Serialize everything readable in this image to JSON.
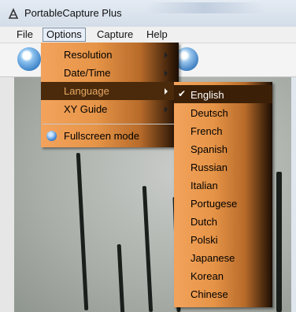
{
  "window": {
    "title": "PortableCapture Plus"
  },
  "menubar": {
    "items": [
      {
        "label": "File"
      },
      {
        "label": "Options"
      },
      {
        "label": "Capture"
      },
      {
        "label": "Help"
      }
    ]
  },
  "options_menu": {
    "items": [
      {
        "label": "Resolution",
        "submenu": true
      },
      {
        "label": "Date/Time",
        "submenu": true
      },
      {
        "label": "Language",
        "submenu": true,
        "highlighted": true
      },
      {
        "label": "XY Guide",
        "submenu": true
      }
    ],
    "fullscreen": {
      "label": "Fullscreen mode",
      "icon": "fullscreen-icon"
    }
  },
  "language_menu": {
    "selected": "English",
    "items": [
      {
        "label": "English"
      },
      {
        "label": "Deutsch"
      },
      {
        "label": "French"
      },
      {
        "label": "Spanish"
      },
      {
        "label": "Russian"
      },
      {
        "label": "Italian"
      },
      {
        "label": "Portugese"
      },
      {
        "label": "Dutch"
      },
      {
        "label": "Polski"
      },
      {
        "label": "Japanese"
      },
      {
        "label": "Korean"
      },
      {
        "label": "Chinese"
      }
    ]
  },
  "colors": {
    "menu_gradient_start": "#f3a35c",
    "menu_gradient_end": "#1b0d02",
    "highlight": "#3b2007"
  }
}
